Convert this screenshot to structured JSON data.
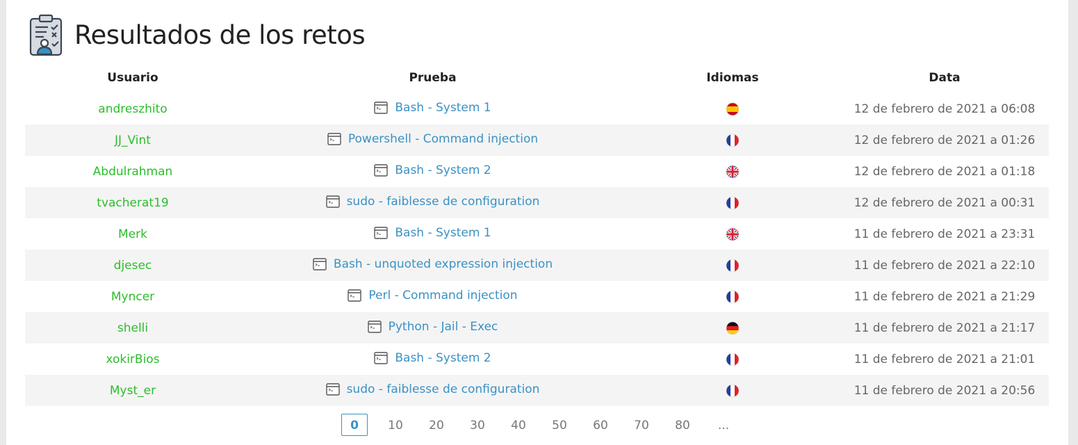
{
  "page": {
    "title": "Resultados de los retos"
  },
  "table": {
    "headers": {
      "user": "Usuario",
      "test": "Prueba",
      "lang": "Idiomas",
      "date": "Data"
    },
    "rows": [
      {
        "user": "andreszhito",
        "test": "Bash - System 1",
        "lang": "es",
        "date": "12 de febrero de 2021 a 06:08"
      },
      {
        "user": "JJ_Vint",
        "test": "Powershell - Command injection",
        "lang": "fr",
        "date": "12 de febrero de 2021 a 01:26"
      },
      {
        "user": "Abdulrahman",
        "test": "Bash - System 2",
        "lang": "en",
        "date": "12 de febrero de 2021 a 01:18"
      },
      {
        "user": "tvacherat19",
        "test": "sudo - faiblesse de configuration",
        "lang": "fr",
        "date": "12 de febrero de 2021 a 00:31"
      },
      {
        "user": "Merk",
        "test": "Bash - System 1",
        "lang": "en",
        "date": "11 de febrero de 2021 a 23:31"
      },
      {
        "user": "djesec",
        "test": "Bash - unquoted expression injection",
        "lang": "fr",
        "date": "11 de febrero de 2021 a 22:10"
      },
      {
        "user": "Myncer",
        "test": "Perl - Command injection",
        "lang": "fr",
        "date": "11 de febrero de 2021 a 21:29"
      },
      {
        "user": "shelli",
        "test": "Python - Jail - Exec",
        "lang": "de",
        "date": "11 de febrero de 2021 a 21:17"
      },
      {
        "user": "xokirBios",
        "test": "Bash - System 2",
        "lang": "fr",
        "date": "11 de febrero de 2021 a 21:01"
      },
      {
        "user": "Myst_er",
        "test": "sudo - faiblesse de configuration",
        "lang": "fr",
        "date": "11 de febrero de 2021 a 20:56"
      }
    ]
  },
  "pagination": {
    "pages": [
      "0",
      "10",
      "20",
      "30",
      "40",
      "50",
      "60",
      "70",
      "80",
      "..."
    ],
    "active": "0"
  },
  "icons": {
    "title": "clipboard-checklist-user-icon",
    "test": "terminal-window-icon",
    "flags": {
      "es": "spain-flag-icon",
      "fr": "france-flag-icon",
      "en": "uk-flag-icon",
      "de": "germany-flag-icon"
    }
  },
  "colors": {
    "user_link": "#2dbd2d",
    "test_link": "#3a91c5",
    "date_text": "#666666",
    "row_alt_bg": "#f4f4f4",
    "active_page": "#3a91c5"
  }
}
